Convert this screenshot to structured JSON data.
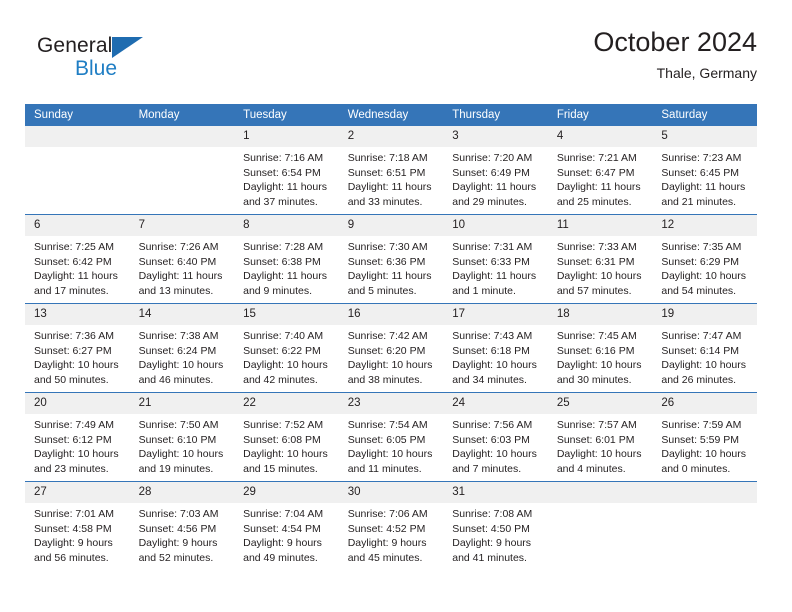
{
  "brand": {
    "name_part1": "General",
    "name_part2": "Blue",
    "triangle_icon": "blue-triangle-icon",
    "accent_color": "#1f7ec4"
  },
  "header": {
    "title": "October 2024",
    "subtitle": "Thale, Germany"
  },
  "colors": {
    "header_blue": "#3575b8",
    "daynum_band": "#f0f0f0",
    "text": "#231f20"
  },
  "weekday_headers": [
    "Sunday",
    "Monday",
    "Tuesday",
    "Wednesday",
    "Thursday",
    "Friday",
    "Saturday"
  ],
  "weeks": [
    [
      {
        "day": "",
        "sunrise": "",
        "sunset": "",
        "daylight": ""
      },
      {
        "day": "",
        "sunrise": "",
        "sunset": "",
        "daylight": ""
      },
      {
        "day": "1",
        "sunrise": "Sunrise: 7:16 AM",
        "sunset": "Sunset: 6:54 PM",
        "daylight": "Daylight: 11 hours and 37 minutes."
      },
      {
        "day": "2",
        "sunrise": "Sunrise: 7:18 AM",
        "sunset": "Sunset: 6:51 PM",
        "daylight": "Daylight: 11 hours and 33 minutes."
      },
      {
        "day": "3",
        "sunrise": "Sunrise: 7:20 AM",
        "sunset": "Sunset: 6:49 PM",
        "daylight": "Daylight: 11 hours and 29 minutes."
      },
      {
        "day": "4",
        "sunrise": "Sunrise: 7:21 AM",
        "sunset": "Sunset: 6:47 PM",
        "daylight": "Daylight: 11 hours and 25 minutes."
      },
      {
        "day": "5",
        "sunrise": "Sunrise: 7:23 AM",
        "sunset": "Sunset: 6:45 PM",
        "daylight": "Daylight: 11 hours and 21 minutes."
      }
    ],
    [
      {
        "day": "6",
        "sunrise": "Sunrise: 7:25 AM",
        "sunset": "Sunset: 6:42 PM",
        "daylight": "Daylight: 11 hours and 17 minutes."
      },
      {
        "day": "7",
        "sunrise": "Sunrise: 7:26 AM",
        "sunset": "Sunset: 6:40 PM",
        "daylight": "Daylight: 11 hours and 13 minutes."
      },
      {
        "day": "8",
        "sunrise": "Sunrise: 7:28 AM",
        "sunset": "Sunset: 6:38 PM",
        "daylight": "Daylight: 11 hours and 9 minutes."
      },
      {
        "day": "9",
        "sunrise": "Sunrise: 7:30 AM",
        "sunset": "Sunset: 6:36 PM",
        "daylight": "Daylight: 11 hours and 5 minutes."
      },
      {
        "day": "10",
        "sunrise": "Sunrise: 7:31 AM",
        "sunset": "Sunset: 6:33 PM",
        "daylight": "Daylight: 11 hours and 1 minute."
      },
      {
        "day": "11",
        "sunrise": "Sunrise: 7:33 AM",
        "sunset": "Sunset: 6:31 PM",
        "daylight": "Daylight: 10 hours and 57 minutes."
      },
      {
        "day": "12",
        "sunrise": "Sunrise: 7:35 AM",
        "sunset": "Sunset: 6:29 PM",
        "daylight": "Daylight: 10 hours and 54 minutes."
      }
    ],
    [
      {
        "day": "13",
        "sunrise": "Sunrise: 7:36 AM",
        "sunset": "Sunset: 6:27 PM",
        "daylight": "Daylight: 10 hours and 50 minutes."
      },
      {
        "day": "14",
        "sunrise": "Sunrise: 7:38 AM",
        "sunset": "Sunset: 6:24 PM",
        "daylight": "Daylight: 10 hours and 46 minutes."
      },
      {
        "day": "15",
        "sunrise": "Sunrise: 7:40 AM",
        "sunset": "Sunset: 6:22 PM",
        "daylight": "Daylight: 10 hours and 42 minutes."
      },
      {
        "day": "16",
        "sunrise": "Sunrise: 7:42 AM",
        "sunset": "Sunset: 6:20 PM",
        "daylight": "Daylight: 10 hours and 38 minutes."
      },
      {
        "day": "17",
        "sunrise": "Sunrise: 7:43 AM",
        "sunset": "Sunset: 6:18 PM",
        "daylight": "Daylight: 10 hours and 34 minutes."
      },
      {
        "day": "18",
        "sunrise": "Sunrise: 7:45 AM",
        "sunset": "Sunset: 6:16 PM",
        "daylight": "Daylight: 10 hours and 30 minutes."
      },
      {
        "day": "19",
        "sunrise": "Sunrise: 7:47 AM",
        "sunset": "Sunset: 6:14 PM",
        "daylight": "Daylight: 10 hours and 26 minutes."
      }
    ],
    [
      {
        "day": "20",
        "sunrise": "Sunrise: 7:49 AM",
        "sunset": "Sunset: 6:12 PM",
        "daylight": "Daylight: 10 hours and 23 minutes."
      },
      {
        "day": "21",
        "sunrise": "Sunrise: 7:50 AM",
        "sunset": "Sunset: 6:10 PM",
        "daylight": "Daylight: 10 hours and 19 minutes."
      },
      {
        "day": "22",
        "sunrise": "Sunrise: 7:52 AM",
        "sunset": "Sunset: 6:08 PM",
        "daylight": "Daylight: 10 hours and 15 minutes."
      },
      {
        "day": "23",
        "sunrise": "Sunrise: 7:54 AM",
        "sunset": "Sunset: 6:05 PM",
        "daylight": "Daylight: 10 hours and 11 minutes."
      },
      {
        "day": "24",
        "sunrise": "Sunrise: 7:56 AM",
        "sunset": "Sunset: 6:03 PM",
        "daylight": "Daylight: 10 hours and 7 minutes."
      },
      {
        "day": "25",
        "sunrise": "Sunrise: 7:57 AM",
        "sunset": "Sunset: 6:01 PM",
        "daylight": "Daylight: 10 hours and 4 minutes."
      },
      {
        "day": "26",
        "sunrise": "Sunrise: 7:59 AM",
        "sunset": "Sunset: 5:59 PM",
        "daylight": "Daylight: 10 hours and 0 minutes."
      }
    ],
    [
      {
        "day": "27",
        "sunrise": "Sunrise: 7:01 AM",
        "sunset": "Sunset: 4:58 PM",
        "daylight": "Daylight: 9 hours and 56 minutes."
      },
      {
        "day": "28",
        "sunrise": "Sunrise: 7:03 AM",
        "sunset": "Sunset: 4:56 PM",
        "daylight": "Daylight: 9 hours and 52 minutes."
      },
      {
        "day": "29",
        "sunrise": "Sunrise: 7:04 AM",
        "sunset": "Sunset: 4:54 PM",
        "daylight": "Daylight: 9 hours and 49 minutes."
      },
      {
        "day": "30",
        "sunrise": "Sunrise: 7:06 AM",
        "sunset": "Sunset: 4:52 PM",
        "daylight": "Daylight: 9 hours and 45 minutes."
      },
      {
        "day": "31",
        "sunrise": "Sunrise: 7:08 AM",
        "sunset": "Sunset: 4:50 PM",
        "daylight": "Daylight: 9 hours and 41 minutes."
      },
      {
        "day": "",
        "sunrise": "",
        "sunset": "",
        "daylight": ""
      },
      {
        "day": "",
        "sunrise": "",
        "sunset": "",
        "daylight": ""
      }
    ]
  ]
}
